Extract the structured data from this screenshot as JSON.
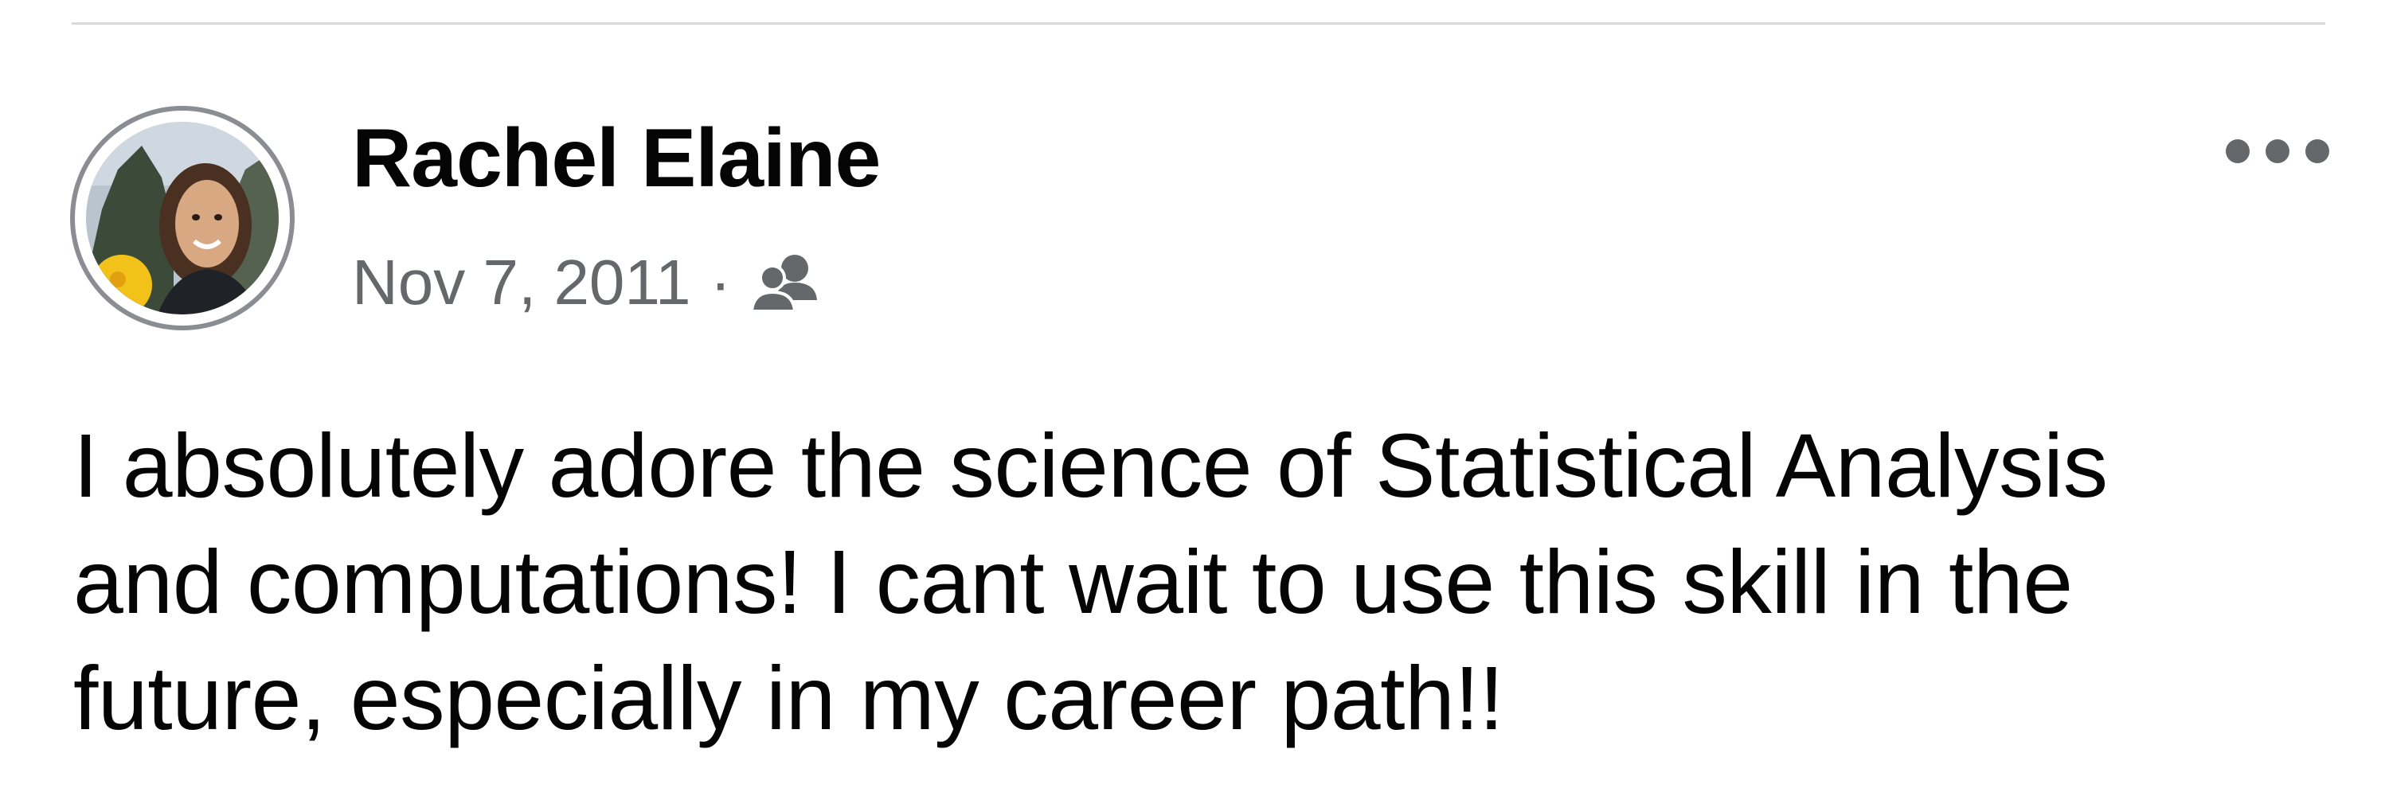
{
  "post": {
    "author_name": "Rachel Elaine",
    "date": "Nov 7, 2011",
    "separator": "·",
    "audience_icon": "friends-icon",
    "more_icon": "more-options-icon",
    "body_text": "I absolutely adore the science of Statistical Analysis\nand computations!  I cant wait to use this skill in the\nfuture, especially in my career path!!"
  },
  "colors": {
    "primary_text": "#050505",
    "secondary_text": "#65676b",
    "divider": "#d9dadc",
    "avatar_ring": "#8a8d91"
  }
}
